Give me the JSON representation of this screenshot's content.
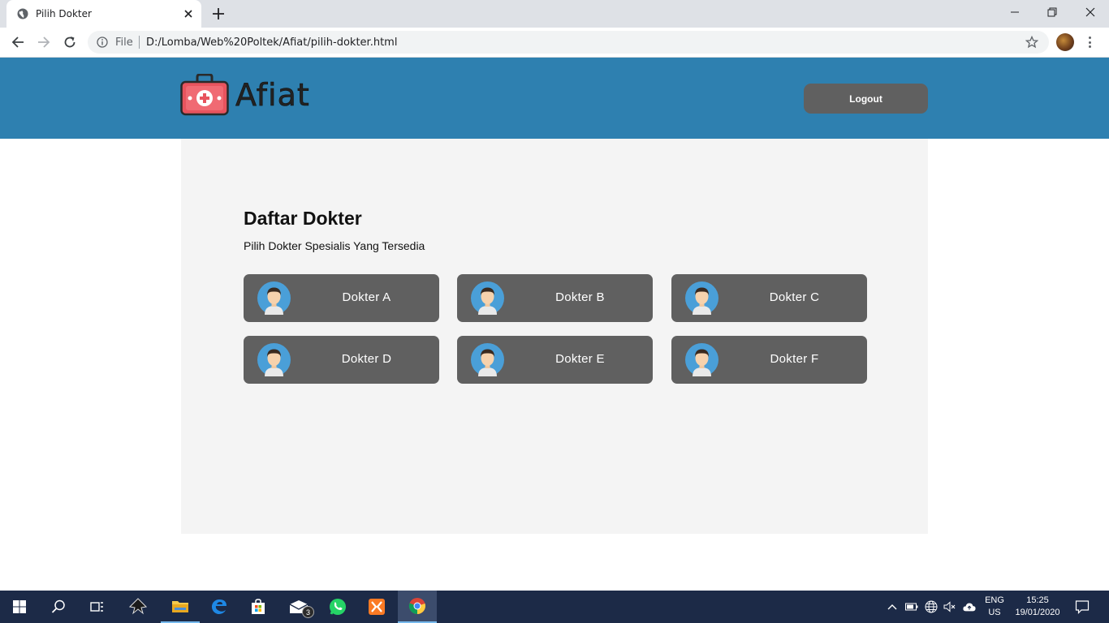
{
  "browser": {
    "tab_title": "Pilih Dokter",
    "scheme_label": "File",
    "url": "D:/Lomba/Web%20Poltek/Afiat/pilih-dokter.html"
  },
  "header": {
    "brand_name": "Afiat",
    "logout_label": "Logout",
    "background_color": "#2e80b0"
  },
  "main": {
    "title": "Daftar Dokter",
    "subtitle": "Pilih Dokter Spesialis Yang Tersedia",
    "doctors": [
      {
        "name": "Dokter A"
      },
      {
        "name": "Dokter B"
      },
      {
        "name": "Dokter C"
      },
      {
        "name": "Dokter D"
      },
      {
        "name": "Dokter E"
      },
      {
        "name": "Dokter F"
      }
    ]
  },
  "taskbar": {
    "mail_badge": "3",
    "language_line1": "ENG",
    "language_line2": "US",
    "time": "15:25",
    "date": "19/01/2020"
  }
}
